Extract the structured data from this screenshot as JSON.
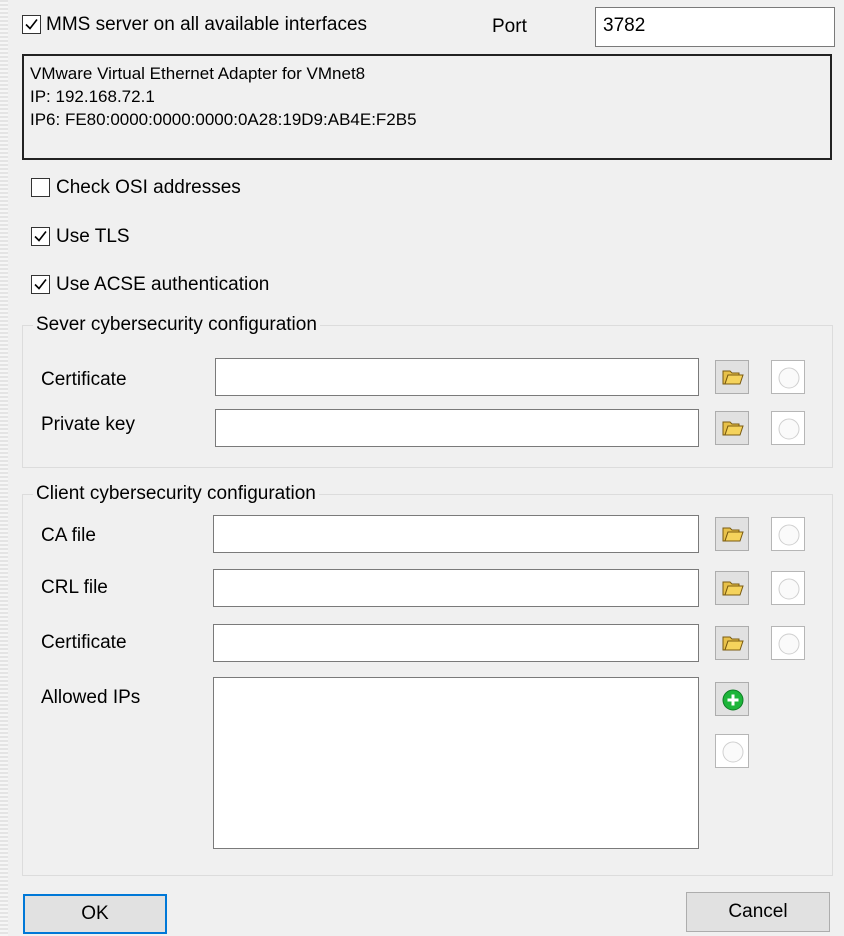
{
  "server": {
    "all_interfaces_label": "MMS server on all available interfaces",
    "all_interfaces_checked": true,
    "port_label": "Port",
    "port_value": "3782"
  },
  "adapter_info": {
    "line1": "VMware Virtual Ethernet Adapter for VMnet8",
    "line2": "IP: 192.168.72.1",
    "line3": "IP6: FE80:0000:0000:0000:0A28:19D9:AB4E:F2B5"
  },
  "options": {
    "check_osi_label": "Check OSI addresses",
    "check_osi_checked": false,
    "use_tls_label": "Use TLS",
    "use_tls_checked": true,
    "use_acse_label": "Use ACSE authentication",
    "use_acse_checked": true
  },
  "server_security": {
    "title": "Sever cybersecurity configuration",
    "certificate_label": "Certificate",
    "certificate_value": "",
    "private_key_label": "Private key",
    "private_key_value": ""
  },
  "client_security": {
    "title": "Client cybersecurity configuration",
    "ca_file_label": "CA file",
    "ca_file_value": "",
    "crl_file_label": "CRL file",
    "crl_file_value": "",
    "certificate_label": "Certificate",
    "certificate_value": "",
    "allowed_ips_label": "Allowed IPs",
    "allowed_ips": []
  },
  "icons": {
    "browse": "folder-icon",
    "clear": "circle-icon",
    "add": "add-icon"
  },
  "colors": {
    "default_button_border": "#0078d7",
    "add_icon_green": "#1db53a",
    "folder_yellow": "#f5d35c"
  },
  "buttons": {
    "ok_label": "OK",
    "cancel_label": "Cancel"
  }
}
